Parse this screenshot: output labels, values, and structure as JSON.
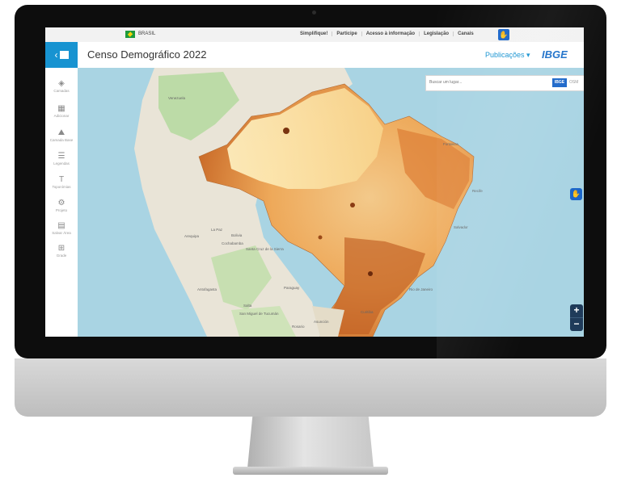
{
  "topbar": {
    "country": "BRASIL",
    "links": [
      "Simplifique!",
      "Participe",
      "Acesso à informação",
      "Legislação",
      "Canais"
    ]
  },
  "app": {
    "title": "Censo Demográfico 2022",
    "publications_label": "Publicações ▾",
    "logo_text": "IBGE"
  },
  "sidebar": {
    "items": [
      {
        "label": "Camadas",
        "icon": "layers-icon",
        "glyph": "◈"
      },
      {
        "label": "Adicionar",
        "icon": "add-layer-icon",
        "glyph": "▦"
      },
      {
        "label": "Camada Base",
        "icon": "base-layer-icon",
        "glyph": "⛰"
      },
      {
        "label": "Legendas",
        "icon": "legend-icon",
        "glyph": "☰"
      },
      {
        "label": "Toponímias",
        "icon": "toponym-icon",
        "glyph": "T"
      },
      {
        "label": "Projeto",
        "icon": "gear-icon",
        "glyph": "⚙"
      },
      {
        "label": "Salvar Área",
        "icon": "save-area-icon",
        "glyph": "▤"
      },
      {
        "label": "Grade",
        "icon": "grid-icon",
        "glyph": "⊞"
      }
    ]
  },
  "search": {
    "placeholder": "Buscar um lugar...",
    "ibge_button": "IBGE",
    "osm_button": "OSM"
  },
  "zoom": {
    "in": "+",
    "out": "−"
  },
  "map_labels": [
    "Venezuela",
    "Bolivia",
    "Paraguay",
    "Santa Cruz de la Sierra",
    "Cochabamba",
    "Arequipa",
    "La Paz",
    "Antofagasta",
    "Asunción",
    "Salta",
    "San Miguel de Tucumán",
    "Rosario",
    "Curitiba",
    "Rio de Janeiro",
    "Recife",
    "Salvador",
    "Fortaleza"
  ],
  "colors": {
    "accent": "#1793d1",
    "ibge_blue": "#1b66c9",
    "ocean": "#a9d4e3"
  }
}
